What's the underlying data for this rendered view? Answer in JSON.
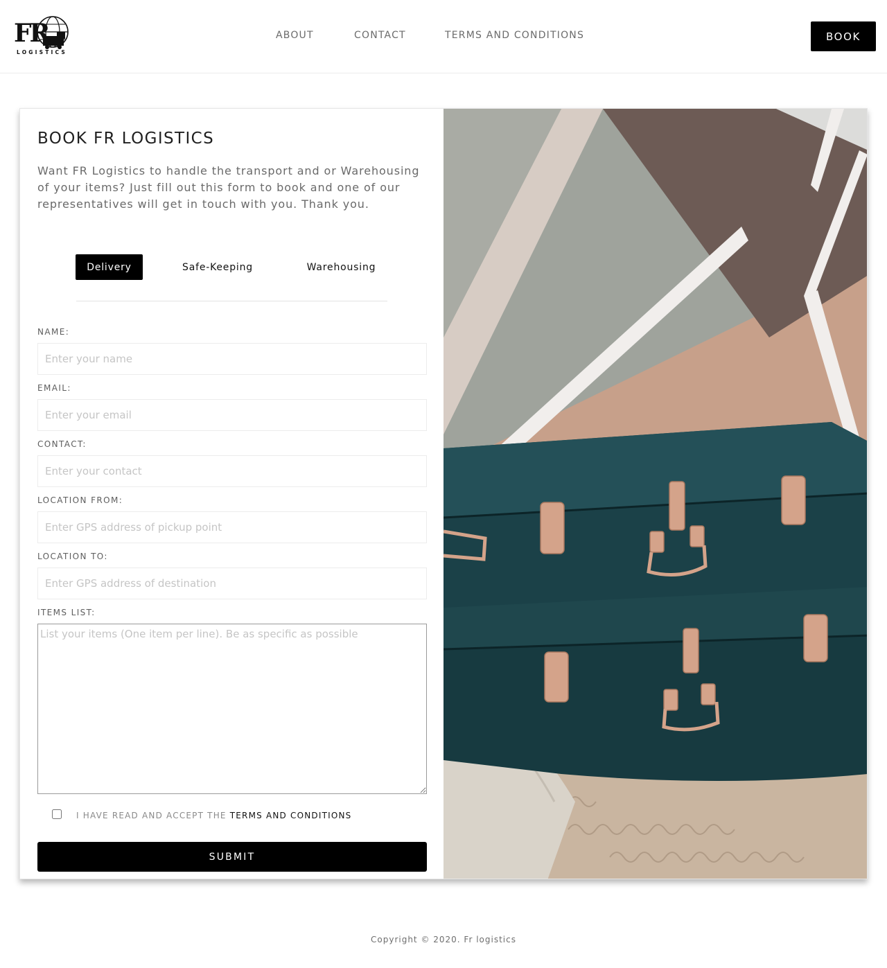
{
  "header": {
    "brand_letters": "FR",
    "brand_sub": "LOGISTICS",
    "nav": [
      "ABOUT",
      "CONTACT",
      "TERMS AND CONDITIONS"
    ],
    "book_label": "BOOK"
  },
  "form": {
    "title": "BOOK FR LOGISTICS",
    "intro": "Want FR Logistics to handle the transport and or Warehousing of your items? Just fill out this form to book and one of our representatives will get in touch with you. Thank you.",
    "tabs": [
      "Delivery",
      "Safe-Keeping",
      "Warehousing"
    ],
    "active_tab": "Delivery",
    "fields": {
      "name": {
        "label": "NAME:",
        "placeholder": "Enter your name"
      },
      "email": {
        "label": "EMAIL:",
        "placeholder": "Enter your email"
      },
      "contact": {
        "label": "CONTACT:",
        "placeholder": "Enter your contact"
      },
      "from": {
        "label": "LOCATION FROM:",
        "placeholder": "Enter GPS address of pickup point"
      },
      "to": {
        "label": "LOCATION TO:",
        "placeholder": "Enter GPS address of destination"
      },
      "items": {
        "label": "ITEMS LIST:",
        "placeholder": "List your items (One item per line). Be as specific as possible"
      }
    },
    "terms_prefix": "I HAVE READ AND ACCEPT THE",
    "terms_link": "TERMS AND CONDITIONS",
    "terms_checked": false,
    "submit_label": "SUBMIT"
  },
  "footer": {
    "copyright": "Copyright © 2020. Fr logistics"
  },
  "colors": {
    "primary": "#000000",
    "text_muted": "#6a6a6a",
    "placeholder": "#c5c5c5"
  }
}
